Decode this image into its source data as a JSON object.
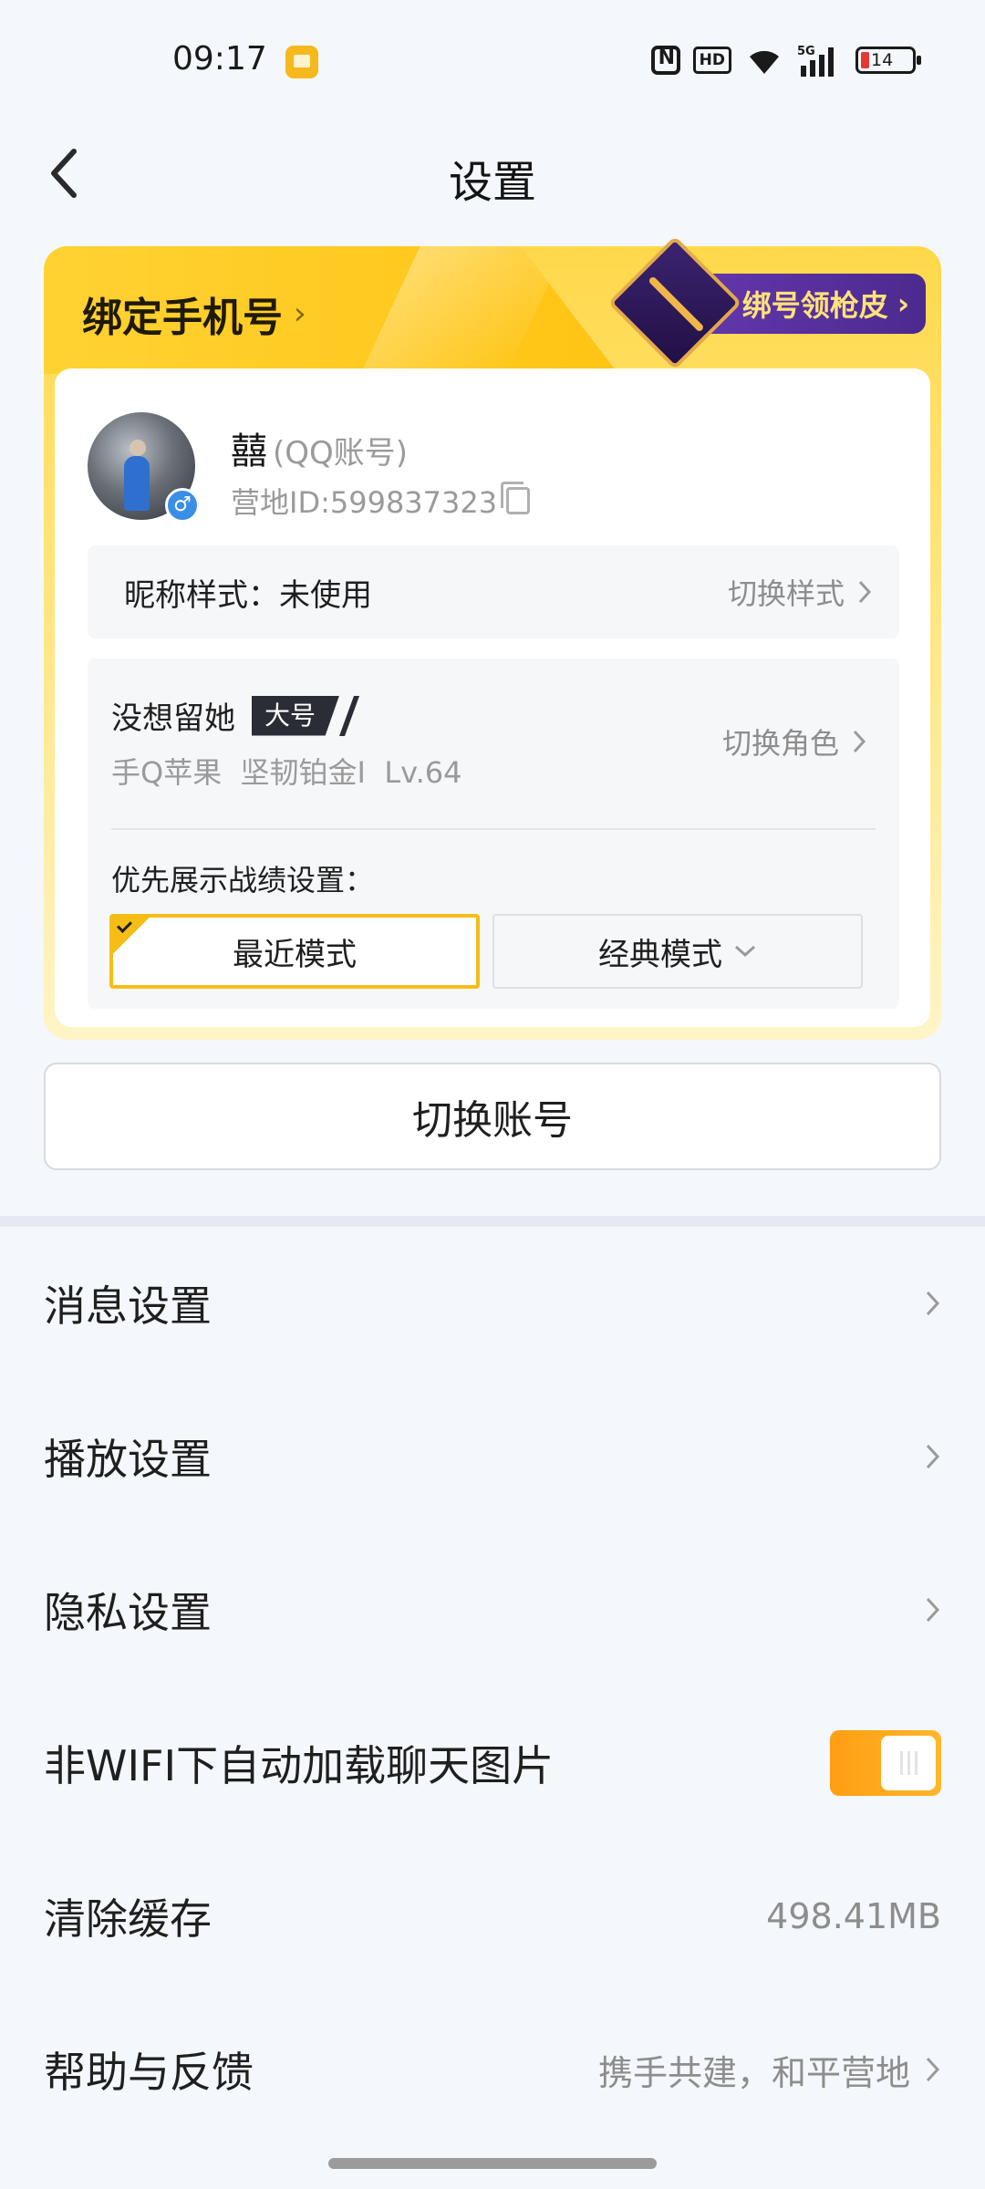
{
  "status_bar": {
    "time": "09:17",
    "hd_label": "HD",
    "network": "5G",
    "battery": "14"
  },
  "header": {
    "back_icon": "back-arrow",
    "title": "设置"
  },
  "account_card": {
    "bind_phone_label": "绑定手机号",
    "skin_badge_label": "绑号领枪皮",
    "user_name": "囍",
    "account_type": "(QQ账号)",
    "camp_id": "营地ID:599837323",
    "gender": "♂",
    "nickname_style_label": "昵称样式：未使用",
    "nickname_style_action": "切换样式",
    "role_name": "没想留她",
    "role_tag": "大号",
    "role_info": "手Q苹果  坚韧铂金I  Lv.64",
    "switch_role_label": "切换角色",
    "record_setting_label": "优先展示战绩设置：",
    "mode_recent": "最近模式",
    "mode_classic": "经典模式"
  },
  "switch_account_label": "切换账号",
  "settings": [
    {
      "label": "消息设置"
    },
    {
      "label": "播放设置"
    },
    {
      "label": "隐私设置"
    },
    {
      "label": "非WIFI下自动加载聊天图片",
      "toggle_on": true
    },
    {
      "label": "清除缓存",
      "value": "498.41MB"
    },
    {
      "label": "帮助与反馈",
      "value": "携手共建，和平营地"
    }
  ],
  "colors": {
    "accent": "#f7bd17",
    "toggle_on": "#ff9e12"
  }
}
